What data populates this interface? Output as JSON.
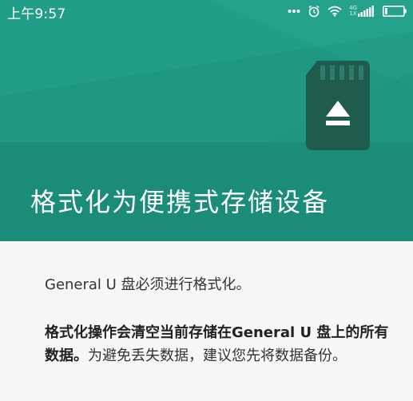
{
  "status_bar": {
    "time": "上午9:57",
    "network_top": "4G",
    "network_bottom": "1X",
    "icons": [
      "more-dots-icon",
      "alarm-icon",
      "wifi-icon",
      "signal-icon",
      "battery-icon"
    ]
  },
  "header": {
    "title": "格式化为便携式存储设备",
    "illustration": "sd-card-eject-icon",
    "colors": {
      "primary": "#1a8c78",
      "light": "#219a85",
      "card": "#1f5c4e",
      "text": "#ffffff"
    }
  },
  "content": {
    "paragraph1": "General U 盘必须进行格式化。",
    "paragraph2_bold": "格式化操作会清空当前存储在General U 盘上的所有数据。",
    "paragraph2_rest": "为避免丢失数据，建议您先将数据备份。"
  }
}
